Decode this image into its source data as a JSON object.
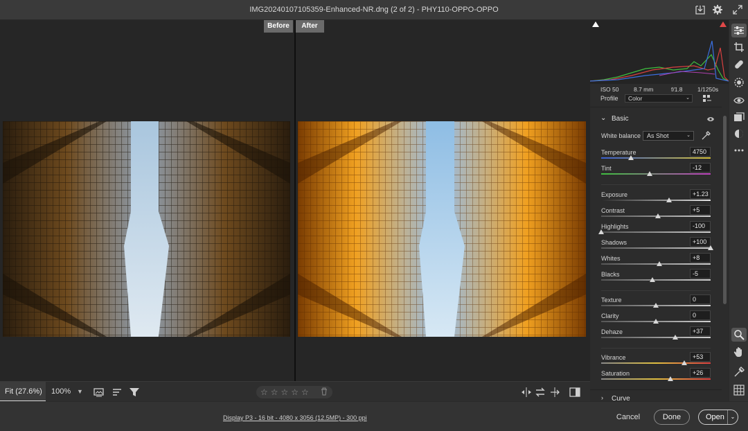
{
  "window": {
    "title": "IMG20240107105359-Enhanced-NR.dng (2 of 2)  -  PHY110-OPPO-OPPO"
  },
  "view": {
    "before_label": "Before",
    "after_label": "After"
  },
  "canvas_bar": {
    "zoom_fit": "Fit (27.6%)",
    "zoom_100": "100%",
    "stars": "☆☆☆☆☆"
  },
  "footer": {
    "info": "Display P3 - 16 bit - 4080 x 3056 (12.5MP) - 300 ppi",
    "cancel": "Cancel",
    "done": "Done",
    "open": "Open"
  },
  "metadata": {
    "iso": "ISO 50",
    "focal": "8.7 mm",
    "aperture": "f/1.8",
    "shutter": "1/1250s"
  },
  "profile": {
    "label": "Profile",
    "value": "Color"
  },
  "basic": {
    "title": "Basic",
    "white_balance_label": "White balance",
    "white_balance_value": "As Shot",
    "temperature": {
      "label": "Temperature",
      "value": "4750",
      "pos": 0.27
    },
    "tint": {
      "label": "Tint",
      "value": "-12",
      "pos": 0.44
    },
    "exposure": {
      "label": "Exposure",
      "value": "+1.23",
      "pos": 0.62
    },
    "contrast": {
      "label": "Contrast",
      "value": "+5",
      "pos": 0.52
    },
    "highlights": {
      "label": "Highlights",
      "value": "-100",
      "pos": 0.0
    },
    "shadows": {
      "label": "Shadows",
      "value": "+100",
      "pos": 1.0
    },
    "whites": {
      "label": "Whites",
      "value": "+8",
      "pos": 0.53
    },
    "blacks": {
      "label": "Blacks",
      "value": "-5",
      "pos": 0.47
    },
    "texture": {
      "label": "Texture",
      "value": "0",
      "pos": 0.5
    },
    "clarity": {
      "label": "Clarity",
      "value": "0",
      "pos": 0.5
    },
    "dehaze": {
      "label": "Dehaze",
      "value": "+37",
      "pos": 0.68
    },
    "vibrance": {
      "label": "Vibrance",
      "value": "+53",
      "pos": 0.76
    },
    "saturation": {
      "label": "Saturation",
      "value": "+26",
      "pos": 0.63
    }
  },
  "curve": {
    "title": "Curve"
  },
  "colors": {
    "accent": "#e0e0e0",
    "panel": "#2c2c2c"
  }
}
